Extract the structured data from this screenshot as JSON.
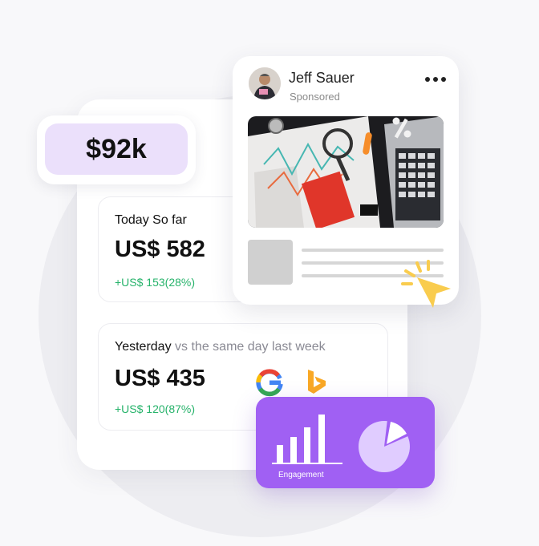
{
  "badge": {
    "amount": "$92k"
  },
  "today": {
    "title": "Today So far",
    "value": "US$ 582",
    "delta": "+US$ 153(28%)"
  },
  "yesterday": {
    "title": "Yesterday",
    "title_muted": "vs the same day last week",
    "value": "US$ 435",
    "delta": "+US$ 120(87%)"
  },
  "ad": {
    "name": "Jeff Sauer",
    "sponsored": "Sponsored"
  },
  "engagement": {
    "label": "Engagement"
  },
  "icons": {
    "more": "more-horizontal-icon",
    "google": "google-icon",
    "bing": "bing-icon",
    "cursor": "cursor-click-icon",
    "bars": "bar-chart-icon",
    "pie": "pie-chart-icon"
  },
  "colors": {
    "badge_bg": "#ebe0fb",
    "delta_green": "#27b36b",
    "engagement_purple": "#a060f3",
    "cursor_yellow": "#f9cc4e",
    "bing_orange": "#f9a825"
  }
}
